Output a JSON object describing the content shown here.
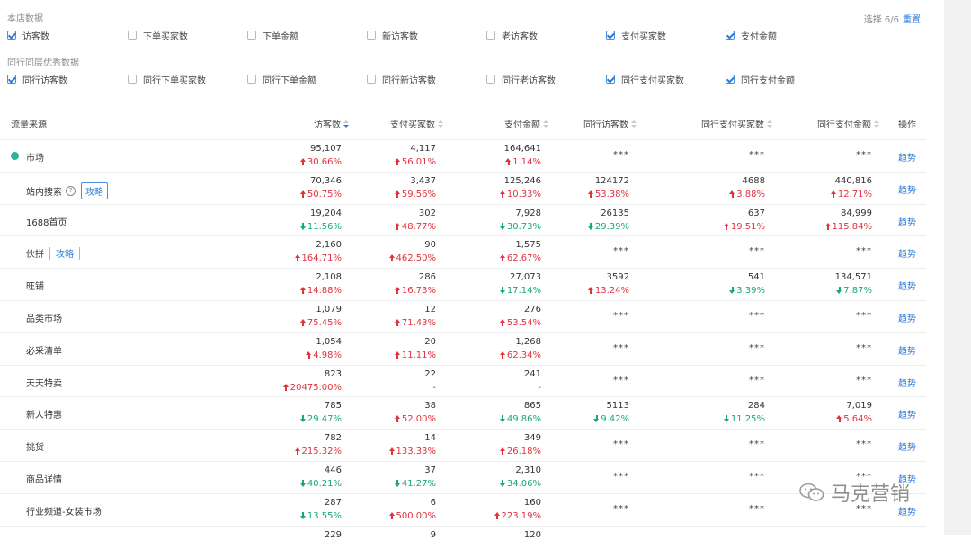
{
  "store_section": {
    "title": "本店数据",
    "items": [
      {
        "label": "访客数",
        "checked": true
      },
      {
        "label": "下单买家数",
        "checked": false
      },
      {
        "label": "下单金额",
        "checked": false
      },
      {
        "label": "新访客数",
        "checked": false
      },
      {
        "label": "老访客数",
        "checked": false
      },
      {
        "label": "支付买家数",
        "checked": true
      },
      {
        "label": "支付金额",
        "checked": true
      }
    ]
  },
  "peer_section": {
    "title": "同行同层优秀数据",
    "items": [
      {
        "label": "同行访客数",
        "checked": true
      },
      {
        "label": "同行下单买家数",
        "checked": false
      },
      {
        "label": "同行下单金额",
        "checked": false
      },
      {
        "label": "同行新访客数",
        "checked": false
      },
      {
        "label": "同行老访客数",
        "checked": false
      },
      {
        "label": "同行支付买家数",
        "checked": true
      },
      {
        "label": "同行支付金额",
        "checked": true
      }
    ]
  },
  "selection": {
    "text": "选择 6/6",
    "reset": "重置"
  },
  "table": {
    "headers": [
      "流量来源",
      "访客数",
      "支付买家数",
      "支付金额",
      "同行访客数",
      "同行支付买家数",
      "同行支付金额",
      "操作"
    ],
    "action_label": "趋势",
    "rows": [
      {
        "source": "市场",
        "dot": true,
        "cells": [
          {
            "v": "95,107",
            "c": "30.66%",
            "d": "up"
          },
          {
            "v": "4,117",
            "c": "56.01%",
            "d": "up"
          },
          {
            "v": "164,641",
            "c": "1.14%",
            "d": "up"
          },
          {
            "m": "***"
          },
          {
            "m": "***"
          },
          {
            "m": "***"
          }
        ]
      },
      {
        "source": "站内搜索",
        "help": "?",
        "tag": "攻略",
        "cells": [
          {
            "v": "70,346",
            "c": "50.75%",
            "d": "up"
          },
          {
            "v": "3,437",
            "c": "59.56%",
            "d": "up"
          },
          {
            "v": "125,246",
            "c": "10.33%",
            "d": "up"
          },
          {
            "v": "124172",
            "c": "53.38%",
            "d": "up"
          },
          {
            "v": "4688",
            "c": "3.88%",
            "d": "up"
          },
          {
            "v": "440,816",
            "c": "12.71%",
            "d": "up"
          }
        ]
      },
      {
        "source": "1688首页",
        "cells": [
          {
            "v": "19,204",
            "c": "11.56%",
            "d": "down"
          },
          {
            "v": "302",
            "c": "48.77%",
            "d": "up"
          },
          {
            "v": "7,928",
            "c": "30.73%",
            "d": "down"
          },
          {
            "v": "26135",
            "c": "29.39%",
            "d": "down"
          },
          {
            "v": "637",
            "c": "19.51%",
            "d": "up"
          },
          {
            "v": "84,999",
            "c": "115.84%",
            "d": "up"
          }
        ]
      },
      {
        "source": "伙拼",
        "tag_plain": "攻略",
        "cells": [
          {
            "v": "2,160",
            "c": "164.71%",
            "d": "up"
          },
          {
            "v": "90",
            "c": "462.50%",
            "d": "up"
          },
          {
            "v": "1,575",
            "c": "62.67%",
            "d": "up"
          },
          {
            "m": "***"
          },
          {
            "m": "***"
          },
          {
            "m": "***"
          }
        ]
      },
      {
        "source": "旺铺",
        "cells": [
          {
            "v": "2,108",
            "c": "14.88%",
            "d": "up"
          },
          {
            "v": "286",
            "c": "16.73%",
            "d": "up"
          },
          {
            "v": "27,073",
            "c": "17.14%",
            "d": "down"
          },
          {
            "v": "3592",
            "c": "13.24%",
            "d": "up"
          },
          {
            "v": "541",
            "c": "3.39%",
            "d": "down"
          },
          {
            "v": "134,571",
            "c": "7.87%",
            "d": "down"
          }
        ]
      },
      {
        "source": "品类市场",
        "cells": [
          {
            "v": "1,079",
            "c": "75.45%",
            "d": "up"
          },
          {
            "v": "12",
            "c": "71.43%",
            "d": "up"
          },
          {
            "v": "276",
            "c": "53.54%",
            "d": "up"
          },
          {
            "m": "***"
          },
          {
            "m": "***"
          },
          {
            "m": "***"
          }
        ]
      },
      {
        "source": "必采清单",
        "cells": [
          {
            "v": "1,054",
            "c": "4.98%",
            "d": "up"
          },
          {
            "v": "20",
            "c": "11.11%",
            "d": "up"
          },
          {
            "v": "1,268",
            "c": "62.34%",
            "d": "up"
          },
          {
            "m": "***"
          },
          {
            "m": "***"
          },
          {
            "m": "***"
          }
        ]
      },
      {
        "source": "天天特卖",
        "cells": [
          {
            "v": "823",
            "c": "20475.00%",
            "d": "up"
          },
          {
            "v": "22",
            "c": "-",
            "d": "none"
          },
          {
            "v": "241",
            "c": "-",
            "d": "none"
          },
          {
            "m": "***"
          },
          {
            "m": "***"
          },
          {
            "m": "***"
          }
        ]
      },
      {
        "source": "新人特惠",
        "cells": [
          {
            "v": "785",
            "c": "29.47%",
            "d": "down"
          },
          {
            "v": "38",
            "c": "52.00%",
            "d": "up"
          },
          {
            "v": "865",
            "c": "49.86%",
            "d": "down"
          },
          {
            "v": "5113",
            "c": "9.42%",
            "d": "down"
          },
          {
            "v": "284",
            "c": "11.25%",
            "d": "down"
          },
          {
            "v": "7,019",
            "c": "5.64%",
            "d": "up"
          }
        ]
      },
      {
        "source": "挑货",
        "cells": [
          {
            "v": "782",
            "c": "215.32%",
            "d": "up"
          },
          {
            "v": "14",
            "c": "133.33%",
            "d": "up"
          },
          {
            "v": "349",
            "c": "26.18%",
            "d": "up"
          },
          {
            "m": "***"
          },
          {
            "m": "***"
          },
          {
            "m": "***"
          }
        ]
      },
      {
        "source": "商品详情",
        "cells": [
          {
            "v": "446",
            "c": "40.21%",
            "d": "down"
          },
          {
            "v": "37",
            "c": "41.27%",
            "d": "down"
          },
          {
            "v": "2,310",
            "c": "34.06%",
            "d": "down"
          },
          {
            "m": "***"
          },
          {
            "m": "***"
          },
          {
            "m": "***"
          }
        ]
      },
      {
        "source": "行业频道-女装市场",
        "cells": [
          {
            "v": "287",
            "c": "13.55%",
            "d": "down"
          },
          {
            "v": "6",
            "c": "500.00%",
            "d": "up"
          },
          {
            "v": "160",
            "c": "223.19%",
            "d": "up"
          },
          {
            "m": "***"
          },
          {
            "m": "***"
          },
          {
            "m": "***"
          }
        ]
      },
      {
        "source": "",
        "cells": [
          {
            "v": "229",
            "c": "",
            "d": "none"
          },
          {
            "v": "9",
            "c": "",
            "d": "none"
          },
          {
            "v": "120",
            "c": "",
            "d": "none"
          },
          {
            "m": ""
          },
          {
            "m": ""
          },
          {
            "m": ""
          }
        ]
      }
    ]
  },
  "watermark": {
    "text": "马克营销",
    "icon": "wechat-icon"
  }
}
